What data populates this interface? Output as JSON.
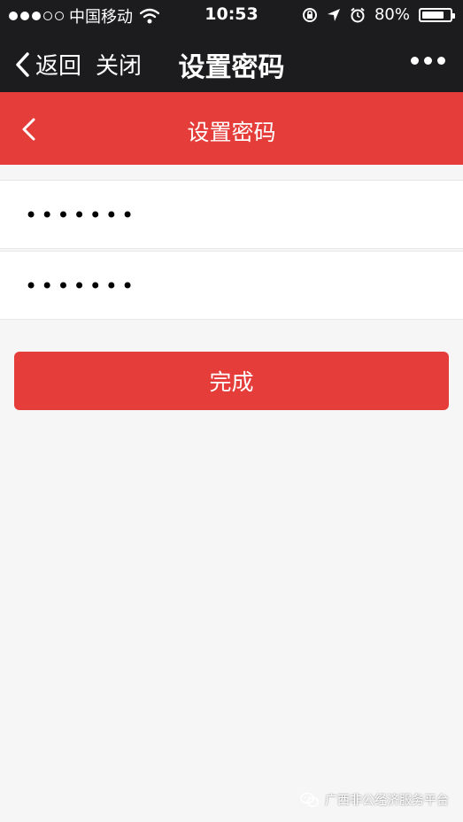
{
  "status_bar": {
    "carrier": "中国移动",
    "time": "10:53",
    "battery": "80%",
    "battery_level": 0.8
  },
  "wechat_nav": {
    "back_label": "返回",
    "close_label": "关闭",
    "title": "设置密码"
  },
  "page_header": {
    "title": "设置密码"
  },
  "form": {
    "password": "1234567",
    "confirm_password": "1234567"
  },
  "submit_label": "完成",
  "watermark": "广西非公经济服务平台",
  "colors": {
    "accent": "#e53e3a",
    "nav_bg": "#1c1c1e",
    "page_bg": "#f7f6f7"
  }
}
